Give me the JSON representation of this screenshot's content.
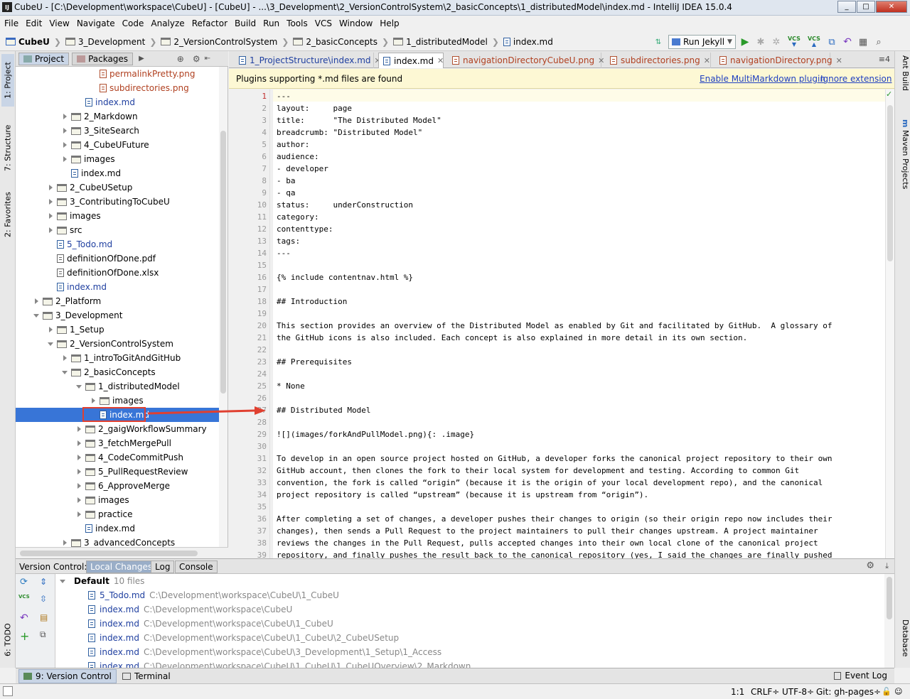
{
  "window": {
    "app_icon": "IJ",
    "title": "CubeU - [C:\\Development\\workspace\\CubeU] - [CubeU] - ...\\3_Development\\2_VersionControlSystem\\2_basicConcepts\\1_distributedModel\\index.md - IntelliJ IDEA 15.0.4",
    "min": "_",
    "max": "□",
    "close": "✕"
  },
  "menu": [
    "File",
    "Edit",
    "View",
    "Navigate",
    "Code",
    "Analyze",
    "Refactor",
    "Build",
    "Run",
    "Tools",
    "VCS",
    "Window",
    "Help"
  ],
  "breadcrumbs": [
    "CubeU",
    "3_Development",
    "2_VersionControlSystem",
    "2_basicConcepts",
    "1_distributedModel",
    "index.md"
  ],
  "toolbar": {
    "run_config": "Run Jekyll",
    "vcs1": "VCS",
    "vcs2": "VCS"
  },
  "project_panel": {
    "tabs": [
      "Project",
      "Packages"
    ],
    "tree": [
      {
        "label": "permalinkPretty.png",
        "depth": 5,
        "kind": "img",
        "expand": "none"
      },
      {
        "label": "subdirectories.png",
        "depth": 5,
        "kind": "img",
        "expand": "none"
      },
      {
        "label": "index.md",
        "depth": 4,
        "kind": "md",
        "expand": "none"
      },
      {
        "label": "2_Markdown",
        "depth": 3,
        "kind": "folder",
        "expand": "closed"
      },
      {
        "label": "3_SiteSearch",
        "depth": 3,
        "kind": "folder",
        "expand": "closed"
      },
      {
        "label": "4_CubeUFuture",
        "depth": 3,
        "kind": "folder",
        "expand": "closed"
      },
      {
        "label": "images",
        "depth": 3,
        "kind": "folder",
        "expand": "closed"
      },
      {
        "label": "index.md",
        "depth": 3,
        "kind": "file",
        "expand": "none"
      },
      {
        "label": "2_CubeUSetup",
        "depth": 2,
        "kind": "folder",
        "expand": "closed"
      },
      {
        "label": "3_ContributingToCubeU",
        "depth": 2,
        "kind": "folder",
        "expand": "closed"
      },
      {
        "label": "images",
        "depth": 2,
        "kind": "folder",
        "expand": "closed"
      },
      {
        "label": "src",
        "depth": 2,
        "kind": "folder",
        "expand": "closed"
      },
      {
        "label": "5_Todo.md",
        "depth": 2,
        "kind": "md",
        "expand": "none"
      },
      {
        "label": "definitionOfDone.pdf",
        "depth": 2,
        "kind": "unk",
        "expand": "none"
      },
      {
        "label": "definitionOfDone.xlsx",
        "depth": 2,
        "kind": "unk",
        "expand": "none"
      },
      {
        "label": "index.md",
        "depth": 2,
        "kind": "md",
        "expand": "none"
      },
      {
        "label": "2_Platform",
        "depth": 1,
        "kind": "folder",
        "expand": "closed"
      },
      {
        "label": "3_Development",
        "depth": 1,
        "kind": "folder",
        "expand": "open"
      },
      {
        "label": "1_Setup",
        "depth": 2,
        "kind": "folder",
        "expand": "closed"
      },
      {
        "label": "2_VersionControlSystem",
        "depth": 2,
        "kind": "folder",
        "expand": "open"
      },
      {
        "label": "1_introToGitAndGitHub",
        "depth": 3,
        "kind": "folder",
        "expand": "closed"
      },
      {
        "label": "2_basicConcepts",
        "depth": 3,
        "kind": "folder",
        "expand": "open"
      },
      {
        "label": "1_distributedModel",
        "depth": 4,
        "kind": "folder",
        "expand": "open"
      },
      {
        "label": "images",
        "depth": 5,
        "kind": "folder",
        "expand": "closed"
      },
      {
        "label": "index.md",
        "depth": 5,
        "kind": "file",
        "expand": "none",
        "selected": true
      },
      {
        "label": "2_gaigWorkflowSummary",
        "depth": 4,
        "kind": "folder",
        "expand": "closed"
      },
      {
        "label": "3_fetchMergePull",
        "depth": 4,
        "kind": "folder",
        "expand": "closed"
      },
      {
        "label": "4_CodeCommitPush",
        "depth": 4,
        "kind": "folder",
        "expand": "closed"
      },
      {
        "label": "5_PullRequestReview",
        "depth": 4,
        "kind": "folder",
        "expand": "closed"
      },
      {
        "label": "6_ApproveMerge",
        "depth": 4,
        "kind": "folder",
        "expand": "closed"
      },
      {
        "label": "images",
        "depth": 4,
        "kind": "folder",
        "expand": "closed"
      },
      {
        "label": "practice",
        "depth": 4,
        "kind": "folder",
        "expand": "closed"
      },
      {
        "label": "index.md",
        "depth": 4,
        "kind": "file",
        "expand": "none"
      },
      {
        "label": "3_advancedConcepts",
        "depth": 3,
        "kind": "folder",
        "expand": "closed"
      }
    ]
  },
  "side_tabs_left": [
    "1: Project",
    "7: Structure",
    "2: Favorites",
    "6: TODO"
  ],
  "side_tabs_right": [
    "Ant Build",
    "Maven Projects",
    "Database"
  ],
  "editor_tabs": [
    {
      "label": "1_ProjectStructure\\index.md",
      "color": "#2040a0"
    },
    {
      "label": "index.md",
      "color": "#000000",
      "selected": true
    },
    {
      "label": "navigationDirectoryCubeU.png",
      "color": "#b04020"
    },
    {
      "label": "subdirectories.png",
      "color": "#b04020"
    },
    {
      "label": "navigationDirectory.png",
      "color": "#b04020"
    }
  ],
  "editor_tab_menu": "≡4",
  "banner": {
    "message": "Plugins supporting *.md files are found",
    "enable": "Enable MultiMarkdown plugin",
    "ignore": "Ignore extension"
  },
  "code_lines": [
    "---",
    "layout:     page",
    "title:      \"The Distributed Model\"",
    "breadcrumb: \"Distributed Model\"",
    "author:",
    "audience:",
    "- developer",
    "- ba",
    "- qa",
    "status:     underConstruction",
    "category:",
    "contenttype:",
    "tags:",
    "---",
    "",
    "{% include contentnav.html %}",
    "",
    "## Introduction",
    "",
    "This section provides an overview of the Distributed Model as enabled by Git and facilitated by GitHub.  A glossary of",
    "the GitHub icons is also included. Each concept is also explained in more detail in its own section.",
    "",
    "## Prerequisites",
    "",
    "* None",
    "",
    "## Distributed Model",
    "",
    "![](images/forkAndPullModel.png){: .image}",
    "",
    "To develop in an open source project hosted on GitHub, a developer forks the canonical project repository to their own",
    "GitHub account, then clones the fork to their local system for development and testing. According to common Git",
    "convention, the fork is called “origin” (because it is the origin of your local development repo), and the canonical",
    "project repository is called “upstream” (because it is upstream from “origin”).",
    "",
    "After completing a set of changes, a developer pushes their changes to origin (so their origin repo now includes their",
    "changes), then sends a Pull Request to the project maintainers to pull their changes upstream. A project maintainer",
    "reviews the changes in the Pull Request, pulls accepted changes into their own local clone of the canonical project",
    "repository, and finally pushes the result back to the canonical repository (yes, I said the changes are finally pushed"
  ],
  "version_control": {
    "label": "Version Control:",
    "tabs": [
      "Local Changes",
      "Log",
      "Console"
    ],
    "group": "Default",
    "count": "10 files",
    "files": [
      {
        "name": "5_Todo.md",
        "path": "C:\\Development\\workspace\\CubeU\\1_CubeU"
      },
      {
        "name": "index.md",
        "path": "C:\\Development\\workspace\\CubeU"
      },
      {
        "name": "index.md",
        "path": "C:\\Development\\workspace\\CubeU\\1_CubeU"
      },
      {
        "name": "index.md",
        "path": "C:\\Development\\workspace\\CubeU\\1_CubeU\\2_CubeUSetup"
      },
      {
        "name": "index.md",
        "path": "C:\\Development\\workspace\\CubeU\\3_Development\\1_Setup\\1_Access"
      },
      {
        "name": "index.md",
        "path": "C:\\Development\\workspace\\CubeU\\1_CubeU\\1_CubeUOverview\\2_Markdown"
      }
    ]
  },
  "bottom_tabs": [
    "9: Version Control",
    "Terminal"
  ],
  "event_log": "Event Log",
  "status": {
    "position": "1:1",
    "line_sep": "CRLF÷",
    "encoding": "UTF-8÷",
    "branch": "Git: gh-pages÷"
  },
  "colors": {
    "selection": "#3875d7",
    "link": "#2040c0",
    "accent_red": "#e04030",
    "banner_bg": "#fdf8d4"
  }
}
